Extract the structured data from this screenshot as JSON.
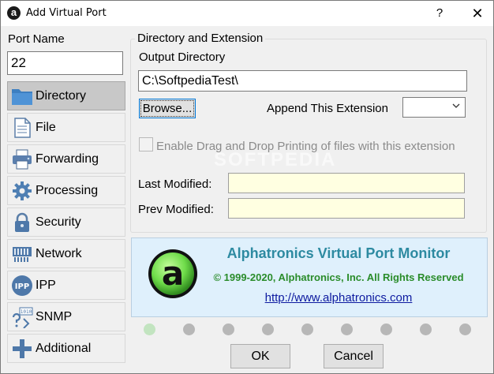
{
  "window": {
    "title": "Add Virtual Port",
    "app_icon_glyph": "a",
    "help_glyph": "?",
    "close_glyph": "✕"
  },
  "port_name": {
    "label": "Port Name",
    "value": "22"
  },
  "sidebar": {
    "items": [
      {
        "label": "Directory",
        "icon": "folder-icon",
        "selected": true
      },
      {
        "label": "File",
        "icon": "file-icon",
        "selected": false
      },
      {
        "label": "Forwarding",
        "icon": "printer-icon",
        "selected": false
      },
      {
        "label": "Processing",
        "icon": "gear-icon",
        "selected": false
      },
      {
        "label": "Security",
        "icon": "lock-icon",
        "selected": false
      },
      {
        "label": "Network",
        "icon": "network-card-icon",
        "selected": false
      },
      {
        "label": "IPP",
        "icon": "ipp-icon",
        "icon_text": "IPP",
        "selected": false
      },
      {
        "label": "SNMP",
        "icon": "snmp-icon",
        "icon_text": "1010",
        "selected": false
      },
      {
        "label": "Additional",
        "icon": "plus-icon",
        "selected": false
      }
    ]
  },
  "directory": {
    "group_title": "Directory and Extension",
    "output_dir_label": "Output Directory",
    "output_dir_value": "C:\\SoftpediaTest\\",
    "browse_label": "Browse...",
    "append_ext_label": "Append This Extension",
    "append_ext_value": "",
    "drag_drop_label": "Enable Drag and Drop Printing of files with this extension",
    "drag_drop_checked": false,
    "last_modified_label": "Last Modified:",
    "last_modified_value": "",
    "prev_modified_label": "Prev Modified:",
    "prev_modified_value": ""
  },
  "banner": {
    "logo_glyph": "a",
    "title": "Alphatronics Virtual Port Monitor",
    "copyright": "© 1999-2020, Alphatronics, Inc. All Rights Reserved",
    "link": "http://www.alphatronics.com"
  },
  "indicator": {
    "count": 9,
    "active_index": 0
  },
  "buttons": {
    "ok": "OK",
    "cancel": "Cancel"
  },
  "watermark": "SOFTPEDIA",
  "colors": {
    "banner_bg": "#dff0fc",
    "banner_title": "#2d8aa1",
    "banner_copy": "#2a8c2a",
    "link": "#0d1aa0",
    "modified_field_bg": "#ffffe1",
    "logo_green": "#7ee05a"
  }
}
